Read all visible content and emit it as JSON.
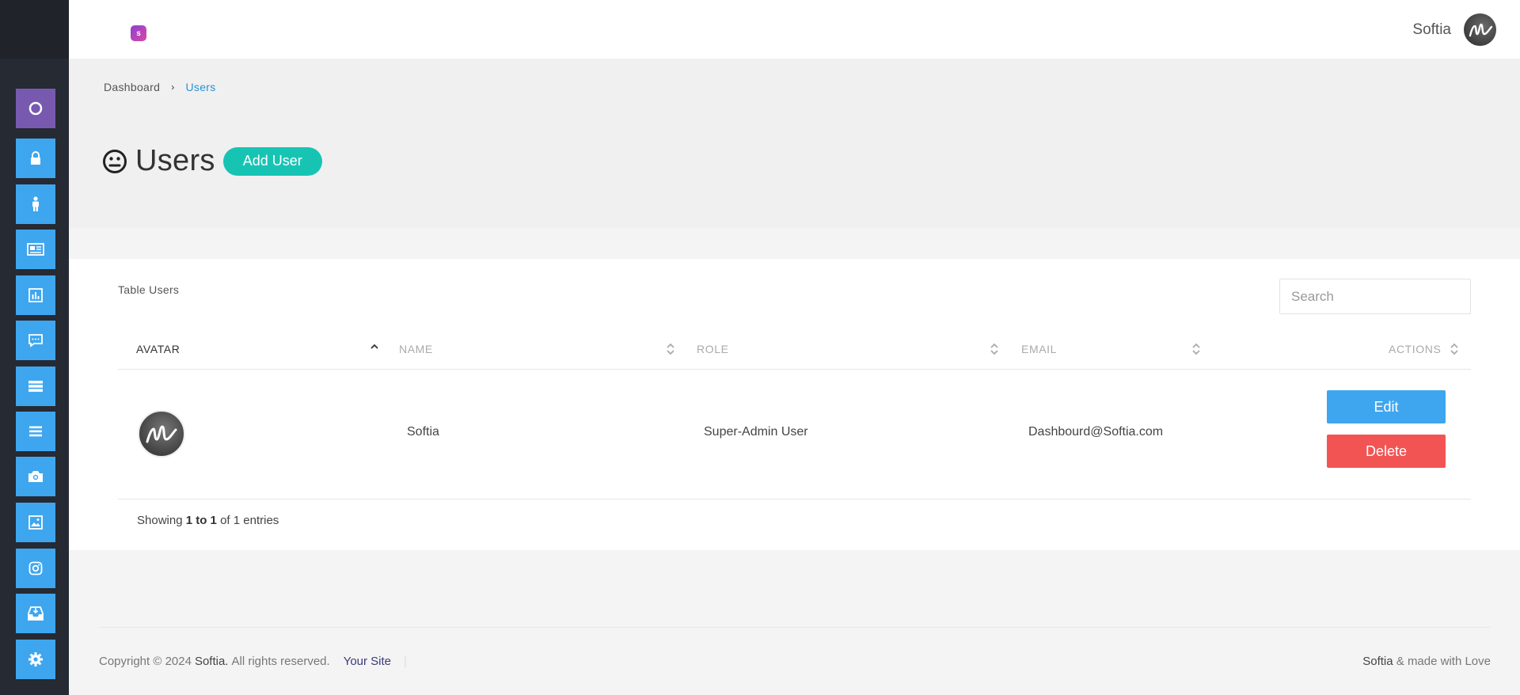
{
  "sidebar": {
    "items": [
      {
        "name": "home-icon",
        "active": true
      },
      {
        "name": "lock-icon"
      },
      {
        "name": "person-icon"
      },
      {
        "name": "newspaper-icon"
      },
      {
        "name": "bar-chart-icon"
      },
      {
        "name": "message-icon"
      },
      {
        "name": "table-icon"
      },
      {
        "name": "list-icon"
      },
      {
        "name": "camera-icon"
      },
      {
        "name": "image-icon"
      },
      {
        "name": "instagram-icon"
      },
      {
        "name": "inbox-icon"
      },
      {
        "name": "gear-icon"
      }
    ]
  },
  "header": {
    "logo_letter": "s",
    "user_name": "Softia"
  },
  "breadcrumb": {
    "home": "Dashboard",
    "separator": "›",
    "current": "Users"
  },
  "page": {
    "title": "Users",
    "add_button": "Add User"
  },
  "table": {
    "title": "Table Users",
    "search_placeholder": "Search",
    "columns": [
      "AVATAR",
      "NAME",
      "ROLE",
      "EMAIL",
      "ACTIONS"
    ],
    "rows": [
      {
        "name": "Softia",
        "role": "Super-Admin User",
        "email": "Dashbourd@Softia.com"
      }
    ],
    "edit_label": "Edit",
    "delete_label": "Delete",
    "showing": {
      "prefix": "Showing",
      "range": "1 to 1",
      "suffix": "of 1 entries"
    }
  },
  "footer": {
    "copyright": "Copyright © 2024",
    "brand": "Softia.",
    "rights": "All rights reserved.",
    "site_link": "Your Site",
    "divider": "|",
    "right_brand": "Softia",
    "right_text": "& made with Love"
  },
  "colors": {
    "sidebar_bg": "#262a33",
    "sidebar_item": "#3ea6ef",
    "sidebar_active": "#7759b0",
    "accent_teal": "#17c4b4",
    "edit_blue": "#3ea6ef",
    "delete_red": "#f25454"
  }
}
